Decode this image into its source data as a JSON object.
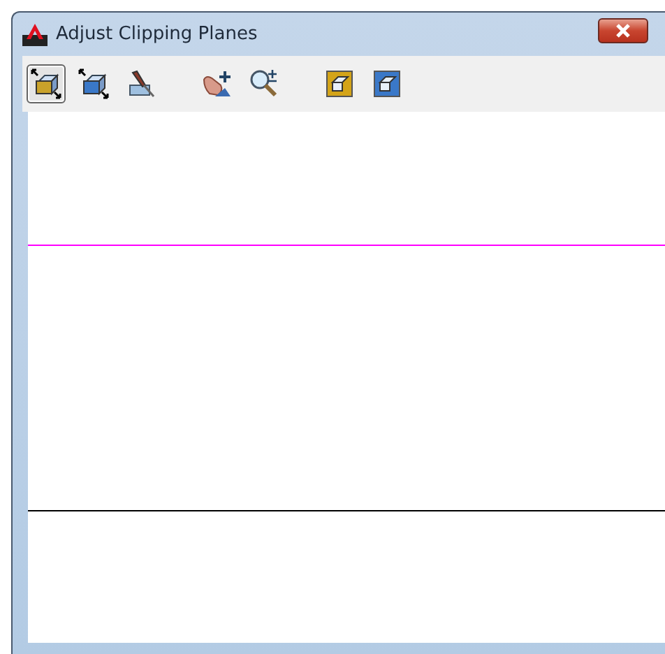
{
  "window": {
    "title": "Adjust Clipping Planes"
  },
  "toolbar": {
    "tools": [
      {
        "kind": "box-arrows",
        "selected": true
      },
      {
        "kind": "box-arrows-blue",
        "selected": false
      },
      {
        "kind": "cutter",
        "selected": false
      },
      {
        "kind": "hand",
        "selected": false
      },
      {
        "kind": "zoom",
        "selected": false
      },
      {
        "kind": "box",
        "selected": false
      },
      {
        "kind": "box-blue",
        "selected": false
      }
    ]
  },
  "planes": [
    {
      "color": "#ff00ff"
    },
    {
      "color": "#000000"
    }
  ]
}
